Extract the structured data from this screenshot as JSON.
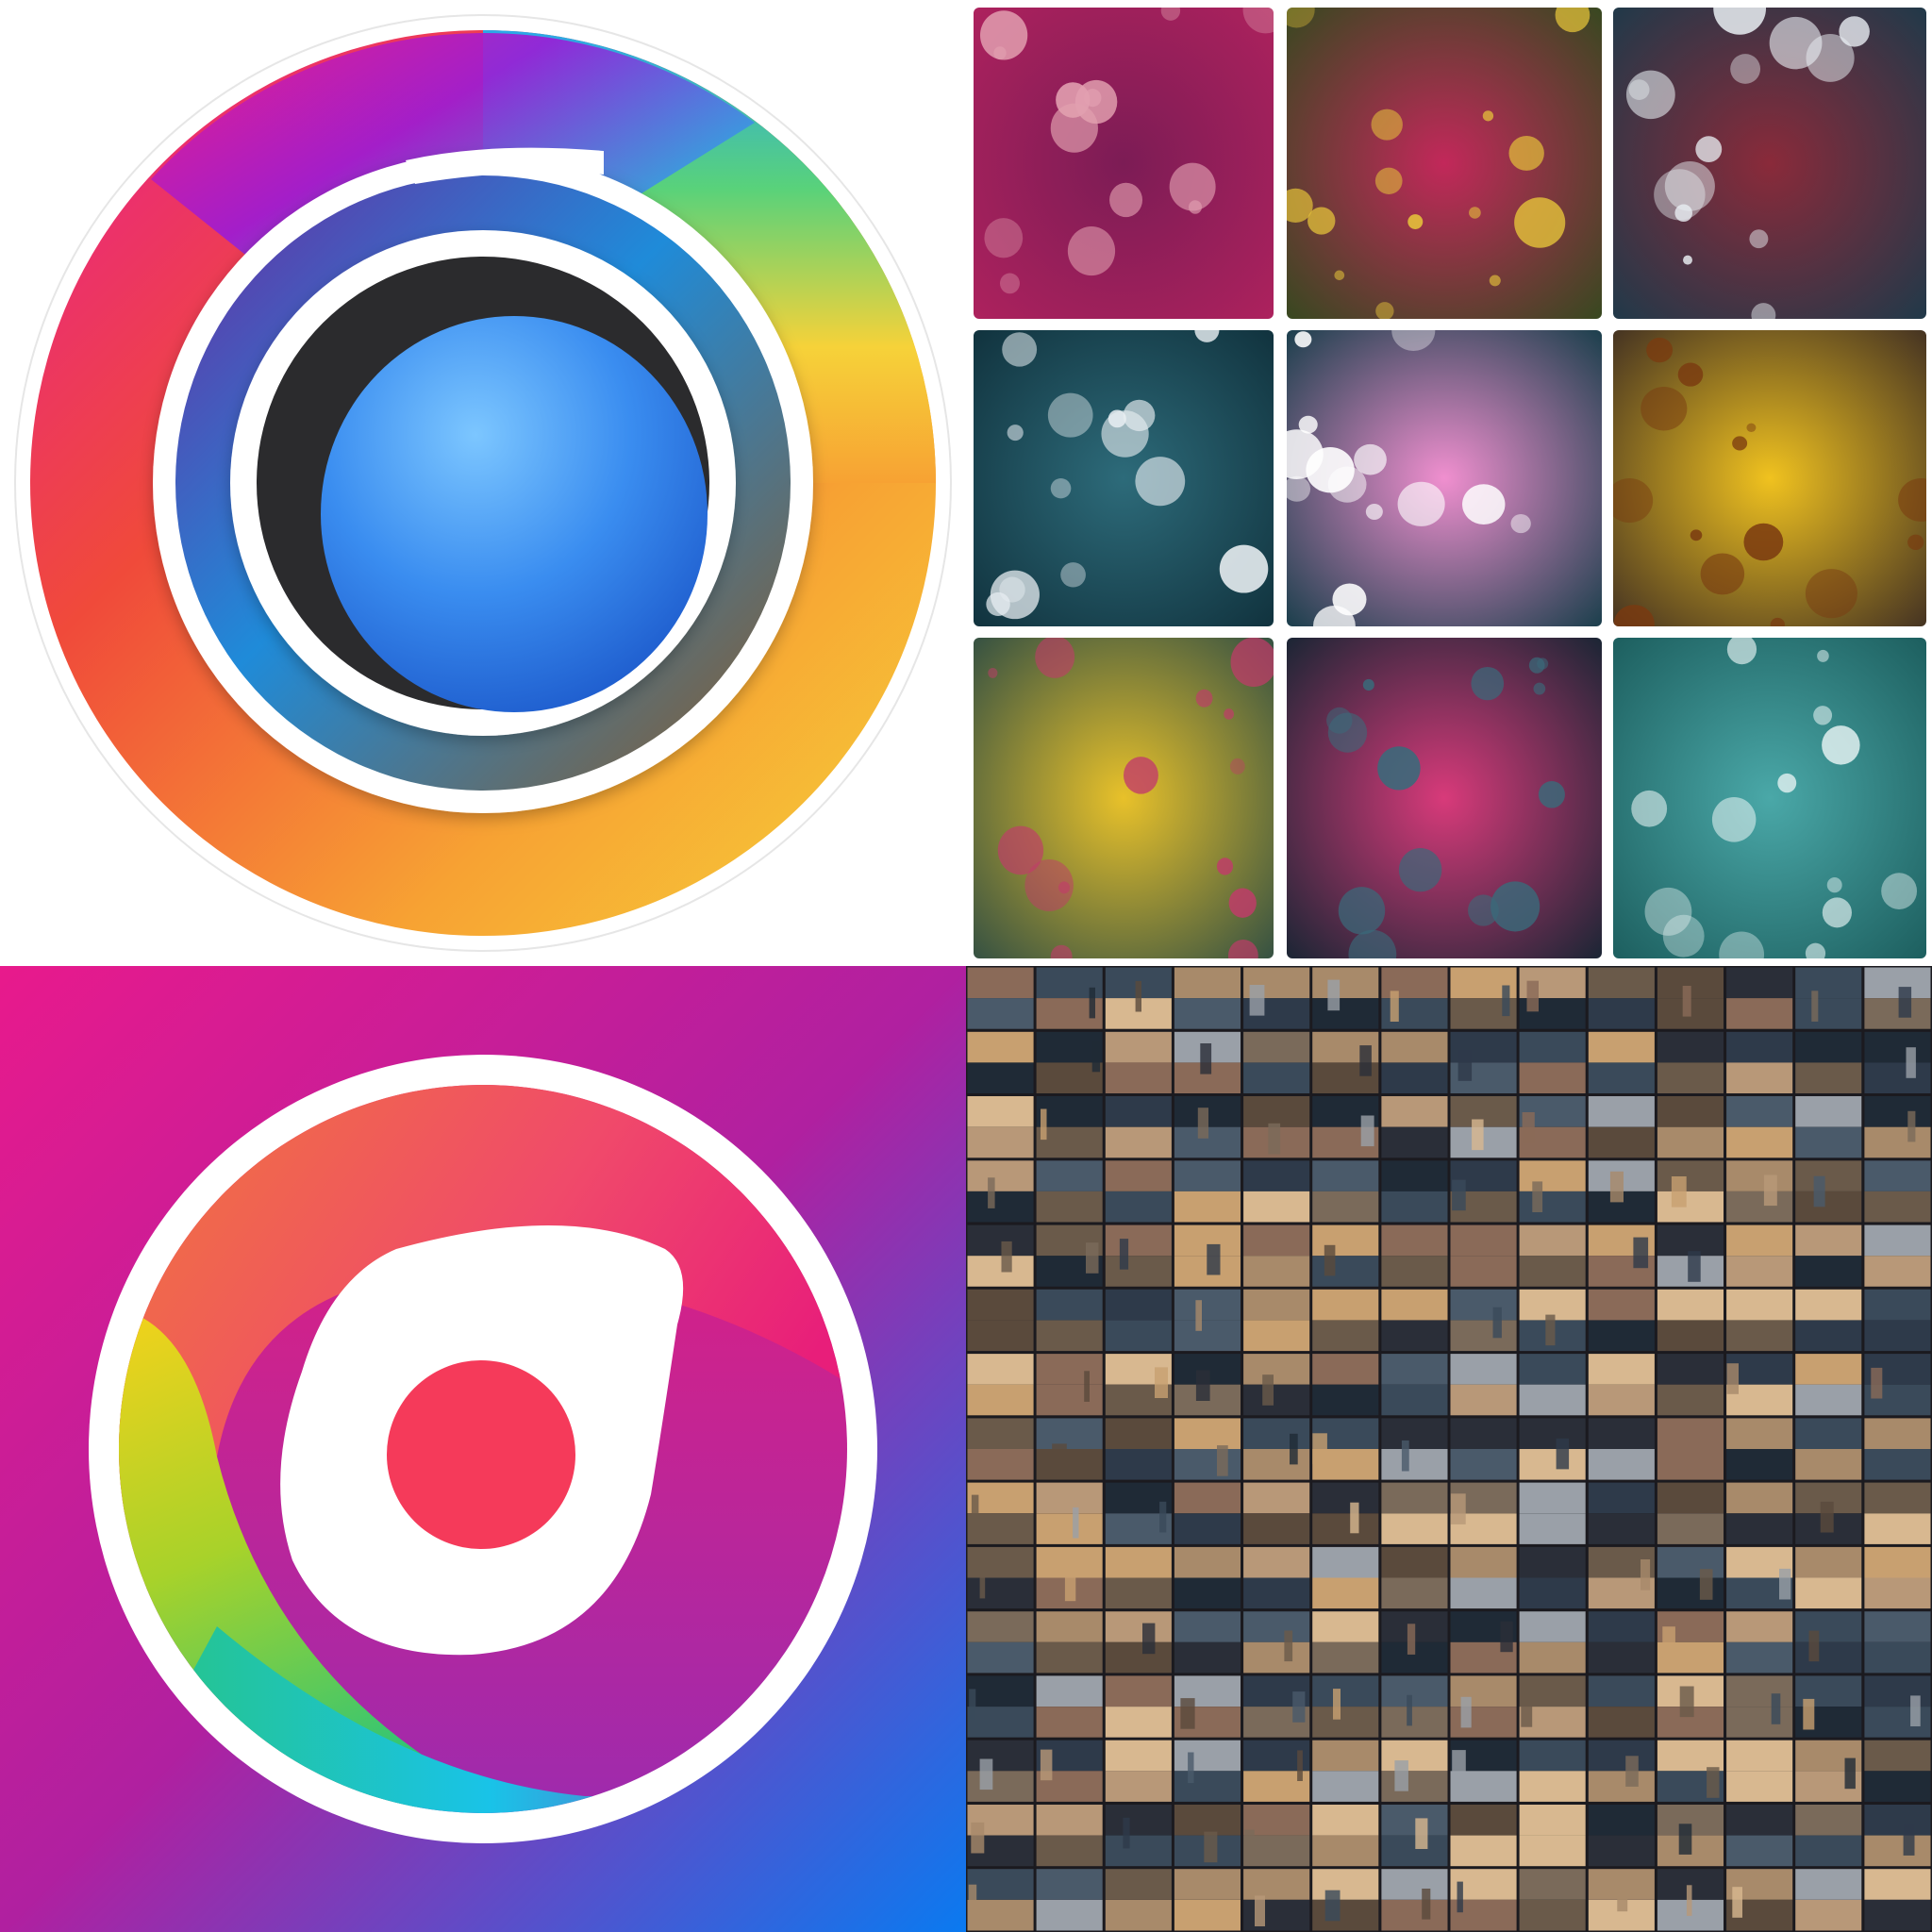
{
  "panels": [
    {
      "name": "ring-logo",
      "colors": {
        "outer_ring": [
          "#9b1bd6",
          "#e81e8f",
          "#f04a3a",
          "#f7a233",
          "#f6d239",
          "#59d27a",
          "#2ba7e8"
        ],
        "inner_ring": [
          "#3a2c8c",
          "#7b2a9a",
          "#1f8bd9",
          "#2ec7a0"
        ],
        "pupil_dark": "#2b2b2d",
        "pupil_blue": "#3a8df0"
      }
    },
    {
      "name": "macro-photo-grid",
      "tiles": [
        {
          "icon": "blurred-magenta-petals",
          "colors": [
            "#b0225e",
            "#7c1c55",
            "#e2a0b0"
          ]
        },
        {
          "icon": "red-spiky-flower",
          "colors": [
            "#2f4a1c",
            "#c2285a",
            "#e8c63a"
          ]
        },
        {
          "icon": "water-drops-teal-red",
          "colors": [
            "#1a3a4a",
            "#8a2a3a",
            "#e8eef2"
          ]
        },
        {
          "icon": "water-droplets-teal",
          "colors": [
            "#0f2f3a",
            "#2d6b7a",
            "#e8eef2"
          ]
        },
        {
          "icon": "pink-dandelion",
          "colors": [
            "#0e3a44",
            "#f08fcf",
            "#ffffff"
          ]
        },
        {
          "icon": "yellow-flower",
          "colors": [
            "#3a2a22",
            "#f0c21f",
            "#7a3a10"
          ]
        },
        {
          "icon": "dewy-yellow-petal",
          "colors": [
            "#2a4a44",
            "#e8c12a",
            "#c23a6a"
          ]
        },
        {
          "icon": "dark-leaf-drops",
          "colors": [
            "#0f2430",
            "#d83a7a",
            "#3a6a7a"
          ]
        },
        {
          "icon": "teal-droplet-surface",
          "colors": [
            "#1a5a5a",
            "#4aa8a8",
            "#e8f4f4"
          ]
        }
      ]
    },
    {
      "name": "camera-app-icon",
      "colors": {
        "background": [
          "#e81a8c",
          "#b020a0",
          "#0a7af0"
        ],
        "ring": "#ffffff",
        "swirl": [
          "#f7d21a",
          "#58c24a",
          "#19c3e8",
          "#f07a3a",
          "#e81e7a",
          "#9a2bb0"
        ],
        "center_dot": "#f53a5a"
      }
    },
    {
      "name": "city-photo-mosaic",
      "columns": 14,
      "rows": 15,
      "palette": [
        "#2e3a4a",
        "#6a5a4a",
        "#a88a6a",
        "#3a4a5a",
        "#c8a070",
        "#1f2a36",
        "#8a6a58",
        "#4a5a6a",
        "#b89878",
        "#5a4a3c",
        "#d8b890",
        "#2a2e38",
        "#7a6a5a",
        "#9aa0a8"
      ]
    }
  ]
}
